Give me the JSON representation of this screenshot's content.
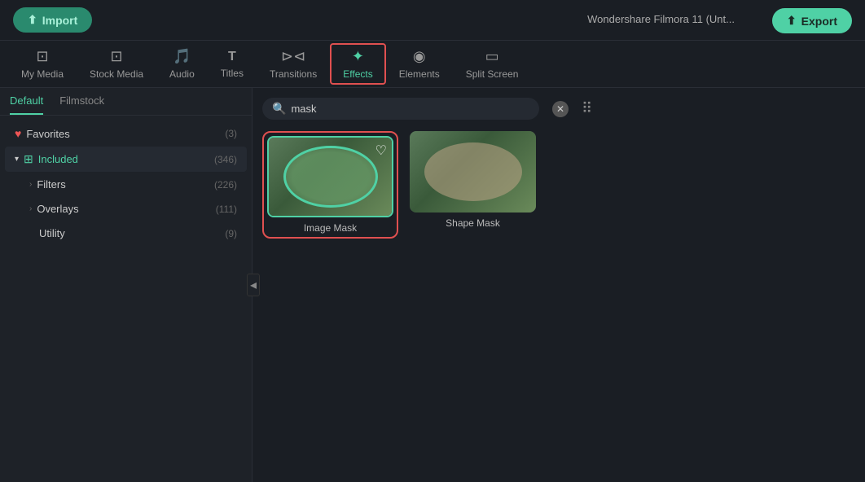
{
  "app": {
    "title": "Wondershare Filmora 11 (Unt...",
    "import_label": "Import",
    "export_label": "Export"
  },
  "nav": {
    "items": [
      {
        "id": "my-media",
        "label": "My Media",
        "icon": "⊡"
      },
      {
        "id": "stock-media",
        "label": "Stock Media",
        "icon": "⊡"
      },
      {
        "id": "audio",
        "label": "Audio",
        "icon": "♪"
      },
      {
        "id": "titles",
        "label": "Titles",
        "icon": "T"
      },
      {
        "id": "transitions",
        "label": "Transitions",
        "icon": "⊳⊲"
      },
      {
        "id": "effects",
        "label": "Effects",
        "icon": "✦",
        "active": true
      },
      {
        "id": "elements",
        "label": "Elements",
        "icon": "◉"
      },
      {
        "id": "split-screen",
        "label": "Split Screen",
        "icon": "▭"
      }
    ]
  },
  "sidebar": {
    "tabs": [
      {
        "id": "default",
        "label": "Default",
        "active": true
      },
      {
        "id": "filmstock",
        "label": "Filmstock",
        "active": false
      }
    ],
    "items": [
      {
        "id": "favorites",
        "label": "Favorites",
        "count": "(3)",
        "icon": "heart"
      },
      {
        "id": "included",
        "label": "Included",
        "count": "(346)",
        "icon": "grid",
        "expanded": true
      },
      {
        "id": "filters",
        "label": "Filters",
        "count": "(226)",
        "sub": true
      },
      {
        "id": "overlays",
        "label": "Overlays",
        "count": "(111)",
        "sub": true
      },
      {
        "id": "utility",
        "label": "Utility",
        "count": "(9)",
        "sub": false,
        "noArrow": true
      }
    ]
  },
  "search": {
    "placeholder": "mask",
    "value": "mask",
    "clear_tooltip": "Clear",
    "grid_tooltip": "Grid view"
  },
  "effects": {
    "items": [
      {
        "id": "image-mask",
        "label": "Image Mask",
        "selected": true,
        "teal_border": true,
        "favorited": true
      },
      {
        "id": "shape-mask",
        "label": "Shape Mask",
        "selected": false,
        "teal_border": false,
        "favorited": false
      }
    ]
  },
  "colors": {
    "accent": "#4fd1a5",
    "red_border": "#e05050",
    "bg_dark": "#1a1e24",
    "bg_mid": "#1e2228",
    "text_muted": "#888888"
  }
}
